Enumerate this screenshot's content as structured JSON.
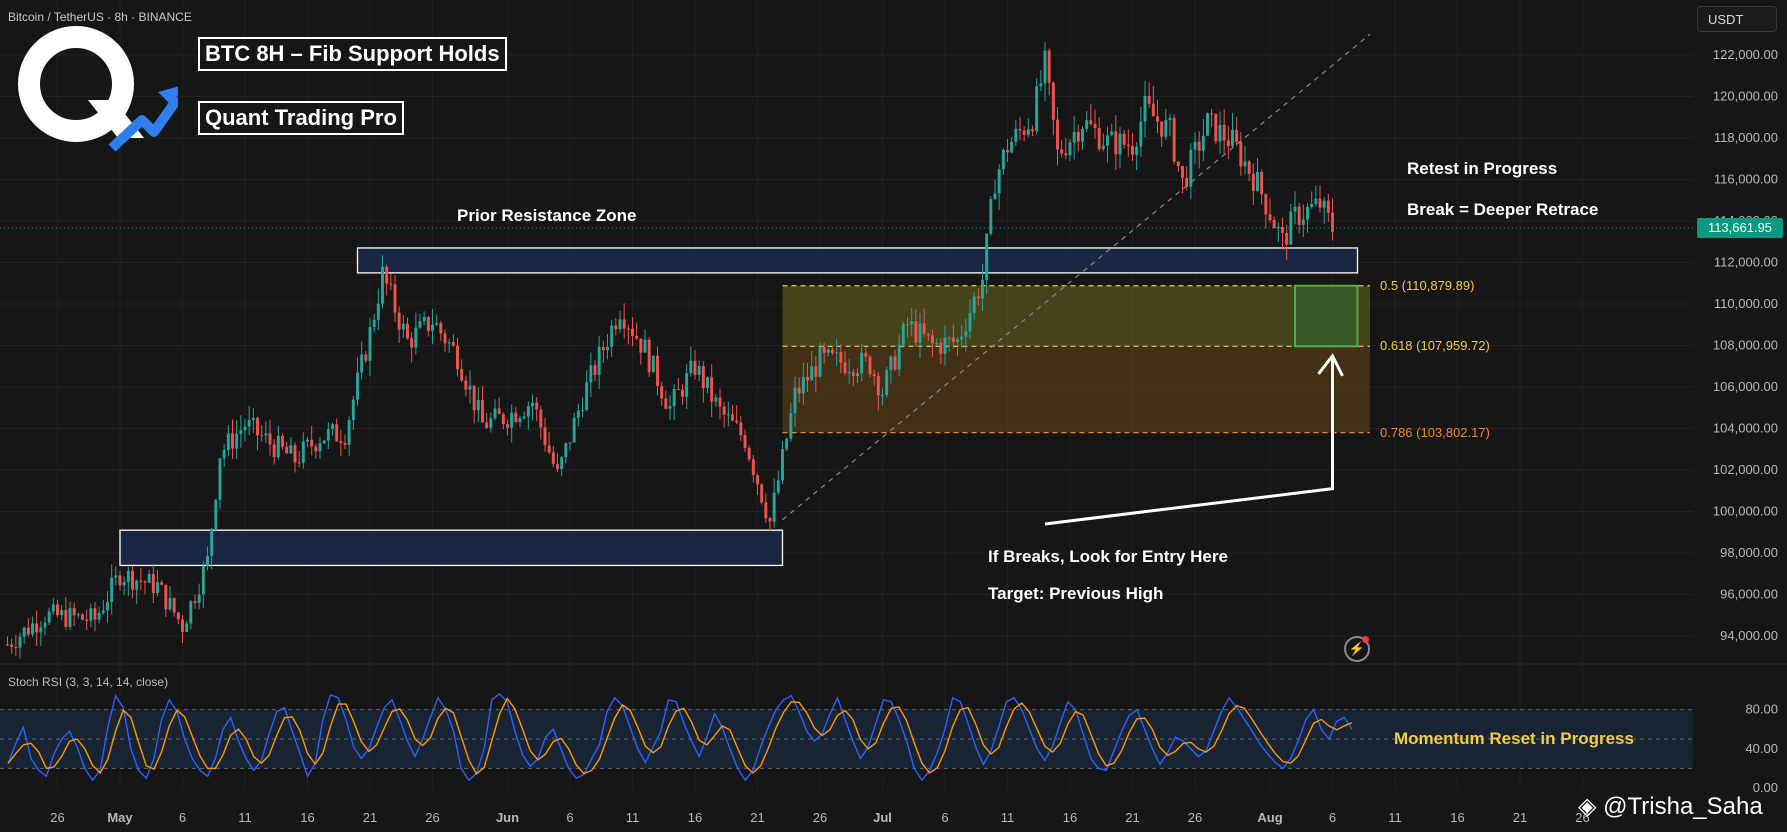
{
  "header": {
    "symbol_line": "Bitcoin / TetherUS · 8h · BINANCE",
    "currency_button": "USDT",
    "last_price": "113,661.95"
  },
  "annotations": {
    "title": "BTC 8H – Fib Support Holds",
    "brand": "Quant Trading Pro",
    "prior_resistance": "Prior Resistance Zone",
    "retest": "Retest in Progress",
    "break_note": "Break = Deeper Retrace",
    "entry_note": "If Breaks, Look for Entry Here",
    "target_note": "Target: Previous High",
    "momentum_note": "Momentum Reset in Progress",
    "watermark": "@Trisha_Saha"
  },
  "fib_levels": [
    {
      "label": "0.5 (110,879.89)",
      "price": 110879.89,
      "color": "#f2cd44"
    },
    {
      "label": "0.618 (107,959.72)",
      "price": 107959.72,
      "color": "#f2cd44"
    },
    {
      "label": "0.786 (103,802.17)",
      "price": 103802.17,
      "color": "#f08a24"
    }
  ],
  "indicator": {
    "name": "Stoch RSI (3, 3, 14, 14, close)",
    "ticks": [
      "80.00",
      "40.00",
      "0.00"
    ],
    "bands": [
      80,
      50,
      20
    ]
  },
  "colors": {
    "up": "#26a69a",
    "down": "#ef5350",
    "zone_border": "#ffffff",
    "zone_fill": "#1a2a4a",
    "k_line": "#2962ff",
    "d_line": "#ff9800",
    "accent": "#2f80ed"
  },
  "chart_data": {
    "type": "candlestick",
    "interval": "8h",
    "price_axis": {
      "min": 92500,
      "max": 123500,
      "ticks": [
        {
          "value": 122000,
          "label": "122,000.00"
        },
        {
          "value": 120000,
          "label": "120,000.00"
        },
        {
          "value": 118000,
          "label": "118,000.00"
        },
        {
          "value": 116000,
          "label": "116,000.00"
        },
        {
          "value": 114000,
          "label": "114,000.00"
        },
        {
          "value": 112000,
          "label": "112,000.00"
        },
        {
          "value": 110000,
          "label": "110,000.00"
        },
        {
          "value": 108000,
          "label": "108,000.00"
        },
        {
          "value": 106000,
          "label": "106,000.00"
        },
        {
          "value": 104000,
          "label": "104,000.00"
        },
        {
          "value": 102000,
          "label": "102,000.00"
        },
        {
          "value": 100000,
          "label": "100,000.00"
        },
        {
          "value": 98000,
          "label": "98,000.00"
        },
        {
          "value": 96000,
          "label": "96,000.00"
        },
        {
          "value": 94000,
          "label": "94,000.00"
        }
      ]
    },
    "time_axis": {
      "ticks": [
        {
          "label": "26",
          "date": "2025-04-26",
          "bold": false
        },
        {
          "label": "May",
          "date": "2025-05-01",
          "bold": true
        },
        {
          "label": "6",
          "date": "2025-05-06",
          "bold": false
        },
        {
          "label": "11",
          "date": "2025-05-11",
          "bold": false
        },
        {
          "label": "16",
          "date": "2025-05-16",
          "bold": false
        },
        {
          "label": "21",
          "date": "2025-05-21",
          "bold": false
        },
        {
          "label": "26",
          "date": "2025-05-26",
          "bold": false
        },
        {
          "label": "Jun",
          "date": "2025-06-01",
          "bold": true
        },
        {
          "label": "6",
          "date": "2025-06-06",
          "bold": false
        },
        {
          "label": "11",
          "date": "2025-06-11",
          "bold": false
        },
        {
          "label": "16",
          "date": "2025-06-16",
          "bold": false
        },
        {
          "label": "21",
          "date": "2025-06-21",
          "bold": false
        },
        {
          "label": "26",
          "date": "2025-06-26",
          "bold": false
        },
        {
          "label": "Jul",
          "date": "2025-07-01",
          "bold": true
        },
        {
          "label": "6",
          "date": "2025-07-06",
          "bold": false
        },
        {
          "label": "11",
          "date": "2025-07-11",
          "bold": false
        },
        {
          "label": "16",
          "date": "2025-07-16",
          "bold": false
        },
        {
          "label": "21",
          "date": "2025-07-21",
          "bold": false
        },
        {
          "label": "26",
          "date": "2025-07-26",
          "bold": false
        },
        {
          "label": "Aug",
          "date": "2025-08-01",
          "bold": true
        },
        {
          "label": "6",
          "date": "2025-08-06",
          "bold": false
        },
        {
          "label": "11",
          "date": "2025-08-11",
          "bold": false
        },
        {
          "label": "16",
          "date": "2025-08-16",
          "bold": false
        },
        {
          "label": "21",
          "date": "2025-08-21",
          "bold": false
        },
        {
          "label": "26",
          "date": "2025-08-26",
          "bold": false
        }
      ]
    },
    "close_path": [
      {
        "date": "2025-04-22",
        "price": 93600
      },
      {
        "date": "2025-04-25",
        "price": 95000
      },
      {
        "date": "2025-04-29",
        "price": 94800
      },
      {
        "date": "2025-05-01",
        "price": 97000
      },
      {
        "date": "2025-05-04",
        "price": 96400
      },
      {
        "date": "2025-05-06",
        "price": 94500
      },
      {
        "date": "2025-05-08",
        "price": 97600
      },
      {
        "date": "2025-05-09",
        "price": 102800
      },
      {
        "date": "2025-05-11",
        "price": 104200
      },
      {
        "date": "2025-05-13",
        "price": 103300
      },
      {
        "date": "2025-05-15",
        "price": 102500
      },
      {
        "date": "2025-05-17",
        "price": 103600
      },
      {
        "date": "2025-05-19",
        "price": 103800
      },
      {
        "date": "2025-05-21",
        "price": 108600
      },
      {
        "date": "2025-05-22",
        "price": 111400
      },
      {
        "date": "2025-05-24",
        "price": 108200
      },
      {
        "date": "2025-05-26",
        "price": 109200
      },
      {
        "date": "2025-05-28",
        "price": 107500
      },
      {
        "date": "2025-05-30",
        "price": 104200
      },
      {
        "date": "2025-06-01",
        "price": 104600
      },
      {
        "date": "2025-06-03",
        "price": 105300
      },
      {
        "date": "2025-06-05",
        "price": 101700
      },
      {
        "date": "2025-06-07",
        "price": 105500
      },
      {
        "date": "2025-06-10",
        "price": 109800
      },
      {
        "date": "2025-06-12",
        "price": 107800
      },
      {
        "date": "2025-06-14",
        "price": 105000
      },
      {
        "date": "2025-06-16",
        "price": 107000
      },
      {
        "date": "2025-06-18",
        "price": 104800
      },
      {
        "date": "2025-06-20",
        "price": 103500
      },
      {
        "date": "2025-06-22",
        "price": 99500
      },
      {
        "date": "2025-06-23",
        "price": 102500
      },
      {
        "date": "2025-06-24",
        "price": 105600
      },
      {
        "date": "2025-06-26",
        "price": 107300
      },
      {
        "date": "2025-06-28",
        "price": 107200
      },
      {
        "date": "2025-06-30",
        "price": 107100
      },
      {
        "date": "2025-07-01",
        "price": 105800
      },
      {
        "date": "2025-07-03",
        "price": 109000
      },
      {
        "date": "2025-07-05",
        "price": 108000
      },
      {
        "date": "2025-07-07",
        "price": 108200
      },
      {
        "date": "2025-07-09",
        "price": 111200
      },
      {
        "date": "2025-07-10",
        "price": 116000
      },
      {
        "date": "2025-07-11",
        "price": 117600
      },
      {
        "date": "2025-07-13",
        "price": 119000
      },
      {
        "date": "2025-07-14",
        "price": 121500
      },
      {
        "date": "2025-07-15",
        "price": 117200
      },
      {
        "date": "2025-07-17",
        "price": 118800
      },
      {
        "date": "2025-07-19",
        "price": 117800
      },
      {
        "date": "2025-07-21",
        "price": 117700
      },
      {
        "date": "2025-07-22",
        "price": 119400
      },
      {
        "date": "2025-07-24",
        "price": 118300
      },
      {
        "date": "2025-07-25",
        "price": 115800
      },
      {
        "date": "2025-07-27",
        "price": 118700
      },
      {
        "date": "2025-07-29",
        "price": 117800
      },
      {
        "date": "2025-07-31",
        "price": 115800
      },
      {
        "date": "2025-08-02",
        "price": 113000
      },
      {
        "date": "2025-08-03",
        "price": 114200
      },
      {
        "date": "2025-08-05",
        "price": 114800
      },
      {
        "date": "2025-08-06",
        "price": 113662
      }
    ],
    "range_pct": 0.012,
    "zones": [
      {
        "name": "prior-resistance",
        "from": "2025-05-20",
        "to": "2025-08-08",
        "low": 111500,
        "high": 112700
      },
      {
        "name": "support-base",
        "from": "2025-05-01",
        "to": "2025-06-23",
        "low": 97400,
        "high": 99100
      }
    ],
    "fib_box": {
      "from": "2025-06-23",
      "to": "2025-08-09",
      "levels": [
        110879.89,
        107959.72,
        103802.17
      ]
    },
    "entry_box": {
      "from": "2025-08-03",
      "to": "2025-08-08",
      "low": 107959.72,
      "high": 110879.89
    },
    "trendline": [
      {
        "date": "2025-06-23",
        "price": 99600
      },
      {
        "date": "2025-08-09",
        "price": 123000
      }
    ],
    "arrow": [
      {
        "date": "2025-07-14",
        "price": 99400
      },
      {
        "date": "2025-08-06",
        "price": 101100
      },
      {
        "date": "2025-08-06",
        "price": 107500
      }
    ],
    "stoch_rsi": {
      "k": [
        25,
        45,
        62,
        30,
        18,
        12,
        35,
        50,
        58,
        42,
        20,
        8,
        18,
        62,
        94,
        82,
        40,
        18,
        10,
        30,
        70,
        90,
        78,
        50,
        30,
        18,
        12,
        30,
        60,
        72,
        48,
        30,
        18,
        28,
        55,
        78,
        82,
        58,
        36,
        12,
        25,
        70,
        95,
        92,
        70,
        42,
        30,
        40,
        62,
        82,
        90,
        70,
        48,
        32,
        50,
        72,
        92,
        80,
        58,
        20,
        8,
        15,
        40,
        90,
        96,
        88,
        58,
        34,
        22,
        30,
        52,
        60,
        40,
        20,
        10,
        14,
        30,
        44,
        78,
        92,
        84,
        62,
        40,
        26,
        42,
        58,
        90,
        88,
        66,
        48,
        32,
        52,
        76,
        62,
        40,
        20,
        8,
        18,
        42,
        62,
        80,
        90,
        94,
        78,
        58,
        48,
        55,
        75,
        92,
        70,
        48,
        30,
        42,
        66,
        90,
        88,
        70,
        48,
        20,
        8,
        18,
        36,
        60,
        92,
        88,
        66,
        42,
        24,
        38,
        62,
        88,
        92,
        80,
        60,
        40,
        28,
        42,
        66,
        88,
        80,
        55,
        30,
        20,
        18,
        38,
        58,
        74,
        80,
        60,
        40,
        24,
        36,
        52,
        48,
        40,
        32,
        38,
        58,
        78,
        92,
        82,
        70,
        58,
        45,
        35,
        26,
        20,
        30,
        48,
        70,
        80,
        60,
        50,
        68,
        72,
        60
      ],
      "d_lag": 2
    }
  }
}
